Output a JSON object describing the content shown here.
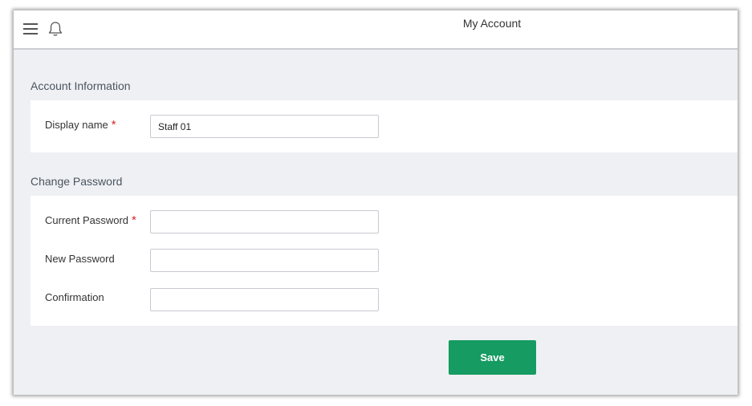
{
  "header": {
    "title": "My Account",
    "menu_icon": "hamburger-menu-icon",
    "notification_icon": "bell-icon"
  },
  "account_info": {
    "section_title": "Account Information",
    "display_name": {
      "label": "Display name",
      "required_mark": "*",
      "value": "Staff 01"
    }
  },
  "change_password": {
    "section_title": "Change Password",
    "current_password": {
      "label": "Current Password",
      "required_mark": "*",
      "value": ""
    },
    "new_password": {
      "label": "New Password",
      "value": ""
    },
    "confirmation": {
      "label": "Confirmation",
      "value": ""
    }
  },
  "actions": {
    "save_label": "Save"
  },
  "colors": {
    "accent": "#169b62",
    "required": "#d7262c",
    "background": "#eff0f3"
  }
}
